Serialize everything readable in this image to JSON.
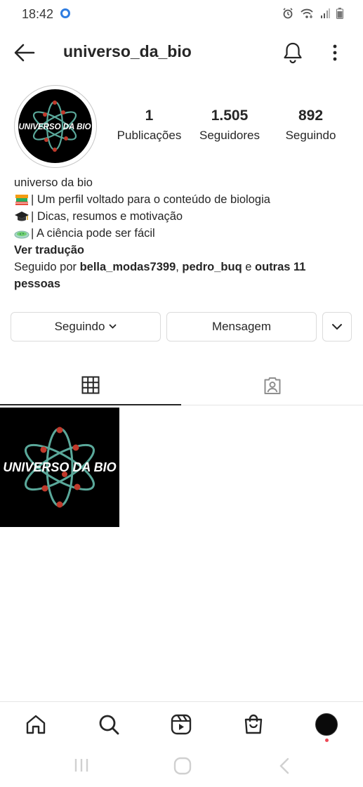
{
  "status_bar": {
    "time": "18:42"
  },
  "header": {
    "username": "universo_da_bio",
    "back_icon": "arrow-left-icon",
    "bell_icon": "bell-icon",
    "more_icon": "vertical-dots-icon"
  },
  "profile": {
    "avatar_text": "UNIVERSO DA BIO",
    "stats": [
      {
        "value": "1",
        "label": "Publicações"
      },
      {
        "value": "1.505",
        "label": "Seguidores"
      },
      {
        "value": "892",
        "label": "Seguindo"
      }
    ]
  },
  "bio": {
    "name": "universo da bio",
    "lines": [
      {
        "icon": "books-emoji",
        "text": "| Um perfil voltado para o conteúdo de biologia"
      },
      {
        "icon": "graduation-cap-emoji",
        "text": "| Dicas, resumos e motivação"
      },
      {
        "icon": "petri-dish-emoji",
        "text": "| A ciência pode ser fácil"
      }
    ],
    "translate": "Ver tradução",
    "followed_by_prefix": "Seguido por ",
    "follower_1": "bella_modas7399",
    "separator": ", ",
    "follower_2": "pedro_buq",
    "connector": " e ",
    "others": "outras 11 pessoas"
  },
  "actions": {
    "following_label": "Seguindo",
    "message_label": "Mensagem"
  },
  "tabs": {
    "grid_icon": "grid-icon",
    "tagged_icon": "tagged-user-icon"
  },
  "post": {
    "text": "UNIVERSO DA BIO"
  },
  "bottom_nav": {
    "items": [
      "home-icon",
      "search-icon",
      "reels-icon",
      "shop-bag-icon",
      "profile-avatar"
    ]
  },
  "colors": {
    "text": "#262626",
    "border": "#dbdbdb",
    "notification": "#ed4956",
    "atom_green": "#5aa89a",
    "atom_red": "#c0392b"
  }
}
